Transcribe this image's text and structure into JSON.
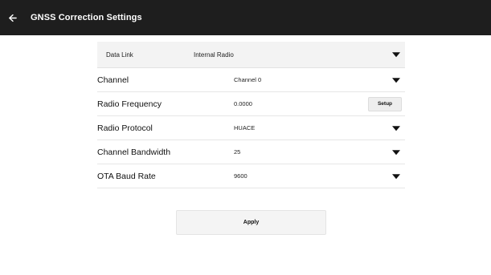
{
  "appbar": {
    "title": "GNSS Correction Settings",
    "back_icon": "arrow-left-icon"
  },
  "settings": {
    "data_link": {
      "label": "Data Link",
      "value": "Internal Radio"
    },
    "channel": {
      "label": "Channel",
      "value": "Channel 0"
    },
    "radio_frequency": {
      "label": "Radio Frequency",
      "value": "0.0000",
      "button": "Setup"
    },
    "radio_protocol": {
      "label": "Radio Protocol",
      "value": "HUACE"
    },
    "channel_bandwidth": {
      "label": "Channel Bandwidth",
      "value": "25"
    },
    "ota_baud_rate": {
      "label": "OTA Baud Rate",
      "value": "9600"
    }
  },
  "apply_label": "Apply",
  "colors": {
    "appbar_bg": "#1e1e1e",
    "appbar_text": "#ffffff",
    "highlight_row": "#f3f3f3"
  }
}
